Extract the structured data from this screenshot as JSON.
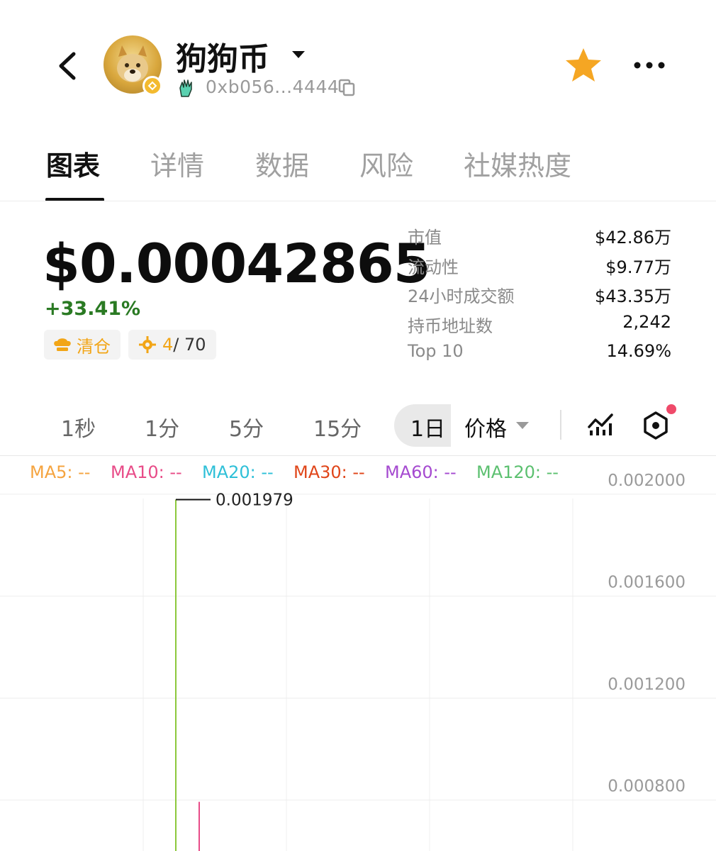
{
  "header": {
    "title": "狗狗币",
    "address": "0xb056...4444",
    "icons": [
      "back-arrow-icon",
      "doge-avatar",
      "bnb-chain-icon",
      "caret-down-icon",
      "hand-icon",
      "copy-icon",
      "star-icon",
      "more-icon"
    ],
    "star_color": "#f5a623"
  },
  "tabs": [
    {
      "label": "图表",
      "active": true
    },
    {
      "label": "详情",
      "active": false
    },
    {
      "label": "数据",
      "active": false
    },
    {
      "label": "风险",
      "active": false
    },
    {
      "label": "社媒热度",
      "active": false
    }
  ],
  "price": {
    "value": "$0.00042865",
    "change": "+33.41%",
    "change_color": "#2a7a23"
  },
  "tags": {
    "clear_label": "清仓",
    "holders_rank": "4",
    "holders_total": " / 70"
  },
  "stats": [
    {
      "label": "市值",
      "value": "$42.86万"
    },
    {
      "label": "流动性",
      "value": "$9.77万"
    },
    {
      "label": "24小时成交额",
      "value": "$43.35万"
    },
    {
      "label": "持币地址数",
      "value": "2,242"
    },
    {
      "label": "Top 10",
      "value": "14.69%"
    }
  ],
  "timeframes": [
    {
      "label": "1秒",
      "active": false
    },
    {
      "label": "1分",
      "active": false
    },
    {
      "label": "5分",
      "active": false
    },
    {
      "label": "15分",
      "active": false
    },
    {
      "label": "1日",
      "active": true
    }
  ],
  "price_mode": "价格",
  "ma_legend": [
    {
      "label": "MA5: --",
      "color": "#f5a440"
    },
    {
      "label": "MA10: --",
      "color": "#e84c88"
    },
    {
      "label": "MA20: --",
      "color": "#2fc0d8"
    },
    {
      "label": "MA30: --",
      "color": "#e0461a"
    },
    {
      "label": "MA60: --",
      "color": "#a54ad0"
    },
    {
      "label": "MA120: --",
      "color": "#5cc070"
    }
  ],
  "chart_data": {
    "type": "line",
    "y_ticks": [
      "0.002000",
      "0.001600",
      "0.001200",
      "0.000800"
    ],
    "ylim": [
      0.0006,
      0.00215
    ],
    "grid": true,
    "high_label": "0.001979",
    "series": [
      {
        "color": "#8cc83c",
        "values": [
          0.001979,
          0.0006
        ]
      },
      {
        "color": "#e84c88",
        "values": [
          0.000793,
          0.0006
        ]
      }
    ]
  }
}
